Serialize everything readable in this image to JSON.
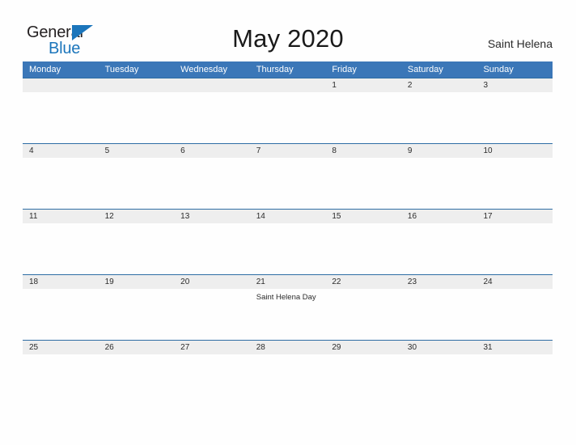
{
  "brand": {
    "name_part1": "General",
    "name_part2": "Blue",
    "flag_color": "#1b75bb"
  },
  "header": {
    "title": "May 2020",
    "location": "Saint Helena"
  },
  "theme": {
    "header_blue": "#3b77b8",
    "row_border_blue": "#2e6da4",
    "date_band_gray": "#eeeeee",
    "page_background": "#fefefe"
  },
  "calendar": {
    "weekdays": [
      "Monday",
      "Tuesday",
      "Wednesday",
      "Thursday",
      "Friday",
      "Saturday",
      "Sunday"
    ],
    "weeks": [
      {
        "days": [
          {
            "date": "",
            "events": []
          },
          {
            "date": "",
            "events": []
          },
          {
            "date": "",
            "events": []
          },
          {
            "date": "",
            "events": []
          },
          {
            "date": "1",
            "events": []
          },
          {
            "date": "2",
            "events": []
          },
          {
            "date": "3",
            "events": []
          }
        ]
      },
      {
        "days": [
          {
            "date": "4",
            "events": []
          },
          {
            "date": "5",
            "events": []
          },
          {
            "date": "6",
            "events": []
          },
          {
            "date": "7",
            "events": []
          },
          {
            "date": "8",
            "events": []
          },
          {
            "date": "9",
            "events": []
          },
          {
            "date": "10",
            "events": []
          }
        ]
      },
      {
        "days": [
          {
            "date": "11",
            "events": []
          },
          {
            "date": "12",
            "events": []
          },
          {
            "date": "13",
            "events": []
          },
          {
            "date": "14",
            "events": []
          },
          {
            "date": "15",
            "events": []
          },
          {
            "date": "16",
            "events": []
          },
          {
            "date": "17",
            "events": []
          }
        ]
      },
      {
        "days": [
          {
            "date": "18",
            "events": []
          },
          {
            "date": "19",
            "events": []
          },
          {
            "date": "20",
            "events": []
          },
          {
            "date": "21",
            "events": [
              "Saint Helena Day"
            ]
          },
          {
            "date": "22",
            "events": []
          },
          {
            "date": "23",
            "events": []
          },
          {
            "date": "24",
            "events": []
          }
        ]
      },
      {
        "days": [
          {
            "date": "25",
            "events": []
          },
          {
            "date": "26",
            "events": []
          },
          {
            "date": "27",
            "events": []
          },
          {
            "date": "28",
            "events": []
          },
          {
            "date": "29",
            "events": []
          },
          {
            "date": "30",
            "events": []
          },
          {
            "date": "31",
            "events": []
          }
        ]
      }
    ]
  }
}
